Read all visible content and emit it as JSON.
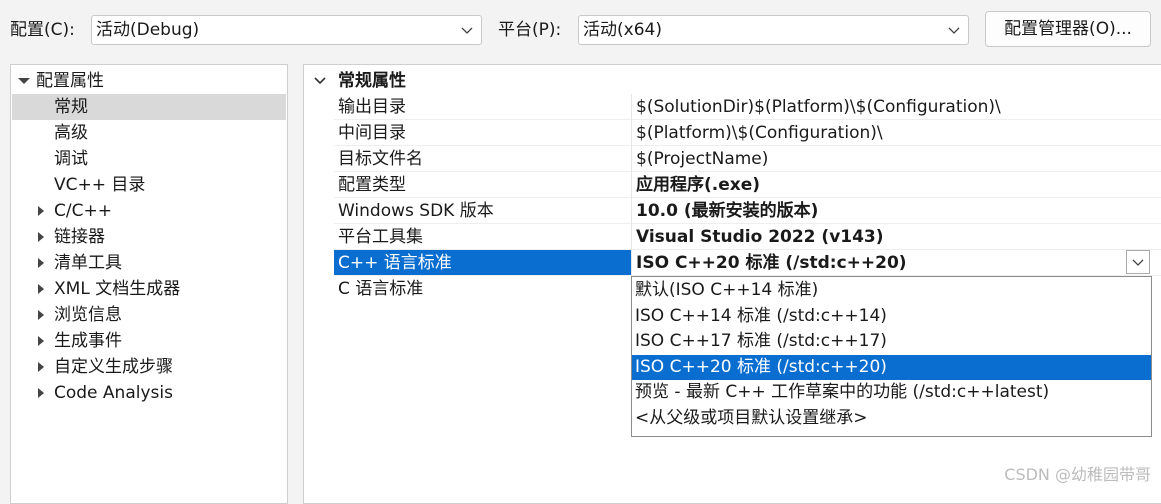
{
  "topbar": {
    "config_label": "配置(C):",
    "config_value": "活动(Debug)",
    "platform_label": "平台(P):",
    "platform_value": "活动(x64)",
    "manager_button": "配置管理器(O)..."
  },
  "tree": {
    "root": "配置属性",
    "items": [
      {
        "label": "常规",
        "selected": true,
        "expandable": false
      },
      {
        "label": "高级",
        "expandable": false
      },
      {
        "label": "调试",
        "expandable": false
      },
      {
        "label": "VC++ 目录",
        "expandable": false
      },
      {
        "label": "C/C++",
        "expandable": true
      },
      {
        "label": "链接器",
        "expandable": true
      },
      {
        "label": "清单工具",
        "expandable": true
      },
      {
        "label": "XML 文档生成器",
        "expandable": true
      },
      {
        "label": "浏览信息",
        "expandable": true
      },
      {
        "label": "生成事件",
        "expandable": true
      },
      {
        "label": "自定义生成步骤",
        "expandable": true
      },
      {
        "label": "Code Analysis",
        "expandable": true
      }
    ]
  },
  "grid": {
    "section": "常规属性",
    "rows": [
      {
        "name": "输出目录",
        "value": "$(SolutionDir)$(Platform)\\$(Configuration)\\",
        "bold": false
      },
      {
        "name": "中间目录",
        "value": "$(Platform)\\$(Configuration)\\",
        "bold": false
      },
      {
        "name": "目标文件名",
        "value": "$(ProjectName)",
        "bold": false
      },
      {
        "name": "配置类型",
        "value": "应用程序(.exe)",
        "bold": true
      },
      {
        "name": "Windows SDK 版本",
        "value": "10.0 (最新安装的版本)",
        "bold": true
      },
      {
        "name": "平台工具集",
        "value": "Visual Studio 2022 (v143)",
        "bold": true
      },
      {
        "name": "C++ 语言标准",
        "value": "ISO C++20 标准 (/std:c++20)",
        "bold": true,
        "selected": true
      },
      {
        "name": "C 语言标准",
        "value": "",
        "bold": false
      }
    ]
  },
  "dropdown": {
    "options": [
      "默认(ISO C++14 标准)",
      "ISO C++14 标准 (/std:c++14)",
      "ISO C++17 标准 (/std:c++17)",
      "ISO C++20 标准 (/std:c++20)",
      "预览 - 最新 C++ 工作草案中的功能 (/std:c++latest)",
      "<从父级或项目默认设置继承>"
    ],
    "selected_index": 3
  },
  "watermark": "CSDN @幼稚园带哥",
  "colors": {
    "selection": "#0a6ed1",
    "tree_selection": "#d9d9d9",
    "background": "#f3f3f3"
  }
}
